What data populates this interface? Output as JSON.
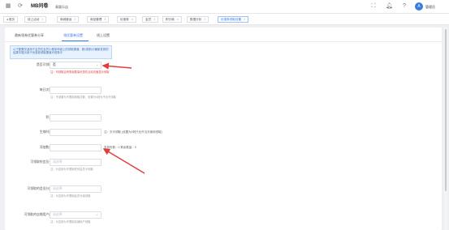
{
  "header": {
    "logo": "MB问卷",
    "store": "青颖乐店",
    "user": "管理员",
    "icons": [
      "grid-icon",
      "refresh-icon",
      "fullscreen-icon",
      "bell-icon",
      "help-icon"
    ]
  },
  "tabs": [
    {
      "label": "首页"
    },
    {
      "label": "线上活动"
    },
    {
      "label": "商城营运"
    },
    {
      "label": "商品管理"
    },
    {
      "label": "优惠券"
    },
    {
      "label": "会员"
    },
    {
      "label": "积分商"
    },
    {
      "label": "数据分析"
    },
    {
      "label": "优惠券领取设置",
      "active": true
    }
  ],
  "subtabs": [
    {
      "label": "邀新领券优惠券分享"
    },
    {
      "label": "领优惠券设置",
      "active": true
    },
    {
      "label": "线上设置"
    }
  ],
  "notice": "以下配置仅适用于会员在会员小程序商城上的领取渠道。即(领券)中最新发券的结果中展示用于优惠券领取渠道可领券中",
  "form": {
    "limit_select": {
      "label": "是否可领取",
      "value": "否",
      "hint": "注：可领取且有剩余数量优惠在活动页面显示领取"
    },
    "daily": {
      "label": "每日次数",
      "hint": "注：不设置为不限制领取次数，设置为0则为不允许领取"
    },
    "points": {
      "label": "积分"
    },
    "expire": {
      "label": "生效时间",
      "hint": "注：天可领取 (设置为0则只允许当天使用领取)"
    },
    "quantity": {
      "label": "添加数量",
      "extra": "发放份数：0 剩余数量：0"
    },
    "member_level": {
      "label": "可领取的会员卡",
      "placeholder": "请选择",
      "hint": "注：为空则为不限制任何会员卡领取"
    },
    "member_tag": {
      "label": "可领取的会员分组",
      "placeholder": "请选择",
      "hint": "注：为空则为不限制会员分组领取"
    },
    "store_type": {
      "label": "可领取的店铺用户群",
      "placeholder": "请选择",
      "hint": "注：为空则为不限制店铺用户领取"
    }
  },
  "colors": {
    "accent": "#3a7be0",
    "annotation": "#e23c3c"
  }
}
